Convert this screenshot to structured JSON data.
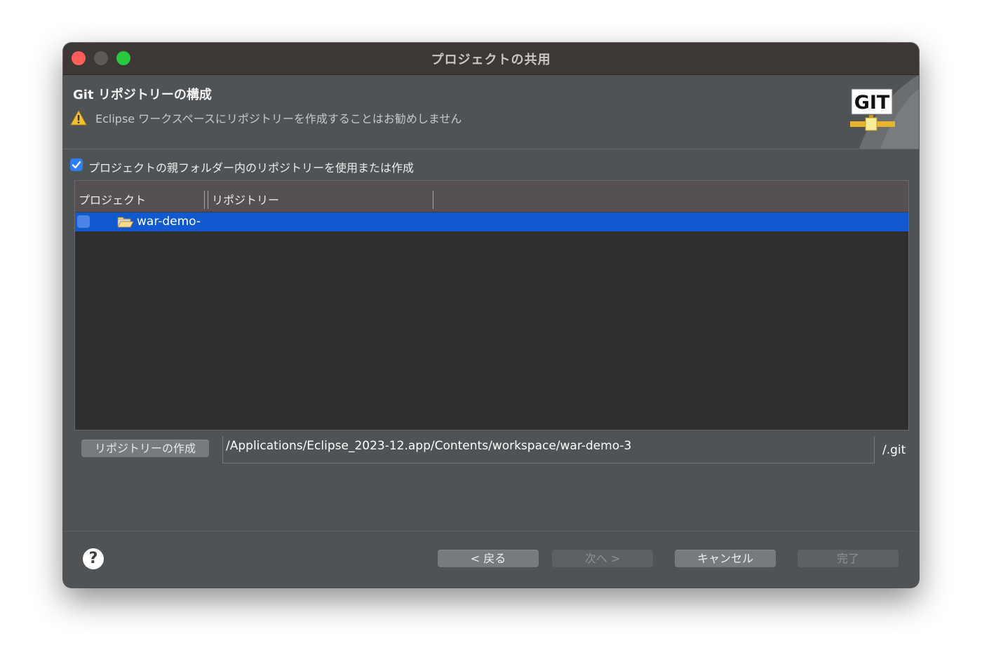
{
  "window": {
    "title": "プロジェクトの共用"
  },
  "header": {
    "title": "Git リポジトリーの構成",
    "warning": "Eclipse ワークスペースにリポジトリーを作成することはお勧めしません",
    "logo_text": "GIT"
  },
  "options": {
    "use_parent_folder_label": "プロジェクトの親フォルダー内のリポジトリーを使用または作成",
    "use_parent_folder_checked": true
  },
  "table": {
    "columns": [
      "プロジェクト",
      "リポジトリー"
    ],
    "rows": [
      {
        "project": "war-demo-",
        "repository": "",
        "checked": false,
        "selected": true
      }
    ]
  },
  "repository": {
    "create_button": "リポジトリーの作成",
    "path": "/Applications/Eclipse_2023-12.app/Contents/workspace/war-demo-3",
    "suffix": "/.git"
  },
  "footer": {
    "help": "?",
    "back": "< 戻る",
    "next": "次へ >",
    "cancel": "キャンセル",
    "finish": "完了"
  },
  "colors": {
    "selection": "#1259cf",
    "checkbox": "#2d7ef6",
    "titlebar": "#3d3736",
    "dialog": "#4f5355"
  }
}
